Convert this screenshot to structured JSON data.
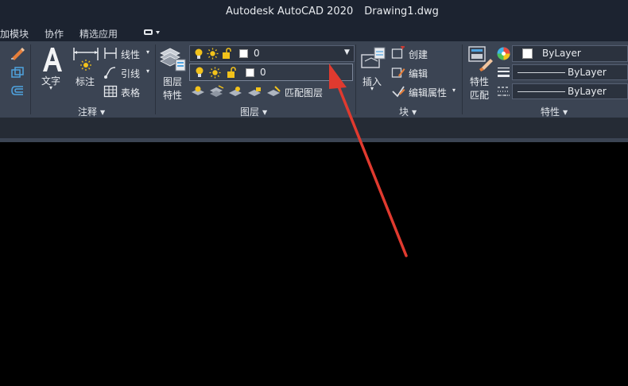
{
  "window": {
    "app_title": "Autodesk AutoCAD 2020",
    "document": "Drawing1.dwg"
  },
  "tabs": [
    {
      "label": "加模块"
    },
    {
      "label": "协作"
    },
    {
      "label": "精选应用"
    }
  ],
  "annotation": {
    "text_label": "文字",
    "dimension_label": "标注",
    "linear_label": "线性",
    "leader_label": "引线",
    "table_label": "表格",
    "panel_label": "注释"
  },
  "layers": {
    "properties_label_line1": "图层",
    "properties_label_line2": "特性",
    "current_layer": "0",
    "second_layer": "0",
    "match_label": "匹配图层",
    "panel_label": "图层"
  },
  "block": {
    "insert_label": "插入",
    "create_label": "创建",
    "edit_label": "编辑",
    "edit_attr_label": "编辑属性",
    "panel_label": "块"
  },
  "properties": {
    "match_line1": "特性",
    "match_line2": "匹配",
    "color_value": "ByLayer",
    "linetype_value": "ByLayer",
    "lineweight_value": "ByLayer",
    "panel_label": "特性"
  },
  "colors": {
    "annotation_arrow": "#e03a2f",
    "bulb": "#f2c21b",
    "ribbon": "#3b4453"
  }
}
